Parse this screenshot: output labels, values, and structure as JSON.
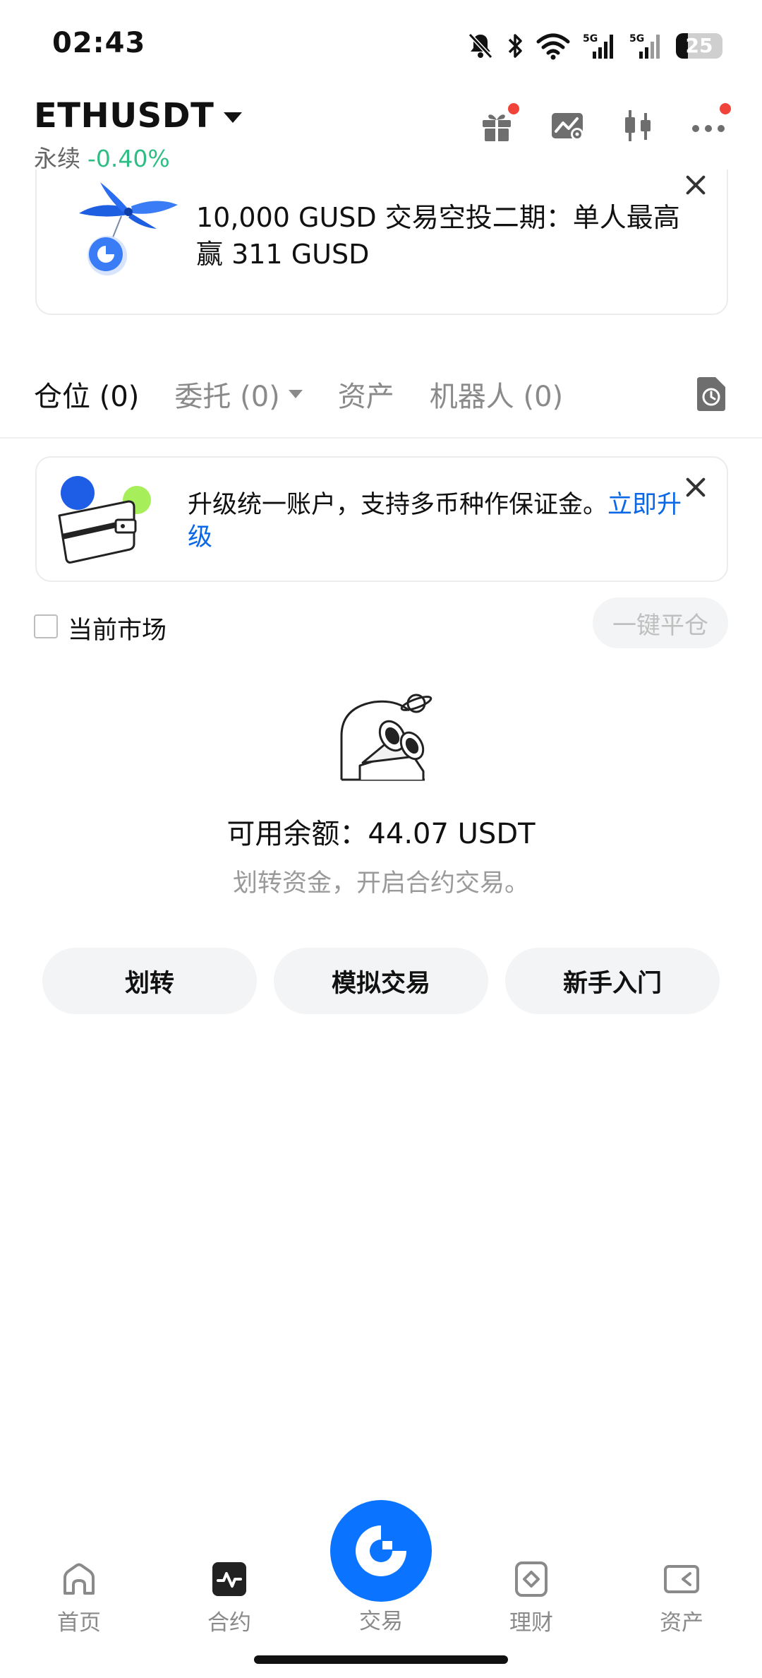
{
  "status_bar": {
    "time": "02:43",
    "battery": "25",
    "battery_level": 0.25
  },
  "header": {
    "symbol": "ETHUSDT",
    "contract_type": "永续",
    "change": "-0.40%"
  },
  "promo": {
    "text": "10,000 GUSD 交易空投二期：单人最高赢 311 GUSD"
  },
  "tabs": [
    {
      "label": "仓位 (0)"
    },
    {
      "label": "委托 (0)"
    },
    {
      "label": "资产"
    },
    {
      "label": "机器人 (0)"
    }
  ],
  "upgrade": {
    "text": "升级统一账户，支持多币种作保证金。",
    "link": "立即升级"
  },
  "filter": {
    "current_market_label": "当前市场",
    "close_all_label": "一键平仓"
  },
  "empty_state": {
    "balance": "可用余额：44.07 USDT",
    "hint": "划转资金，开启合约交易。"
  },
  "actions": [
    {
      "label": "划转"
    },
    {
      "label": "模拟交易"
    },
    {
      "label": "新手入门"
    }
  ],
  "bottom_nav": [
    {
      "label": "首页",
      "icon": "home-icon"
    },
    {
      "label": "合约",
      "icon": "futures-icon"
    },
    {
      "label": "交易",
      "icon": "trade-logo-icon"
    },
    {
      "label": "理财",
      "icon": "earn-icon"
    },
    {
      "label": "资产",
      "icon": "wallet-icon"
    }
  ],
  "colors": {
    "accent": "#0a73ff",
    "link": "#0a67e6",
    "negative_change": "#2ebd85",
    "notification_dot": "#f0443a"
  }
}
